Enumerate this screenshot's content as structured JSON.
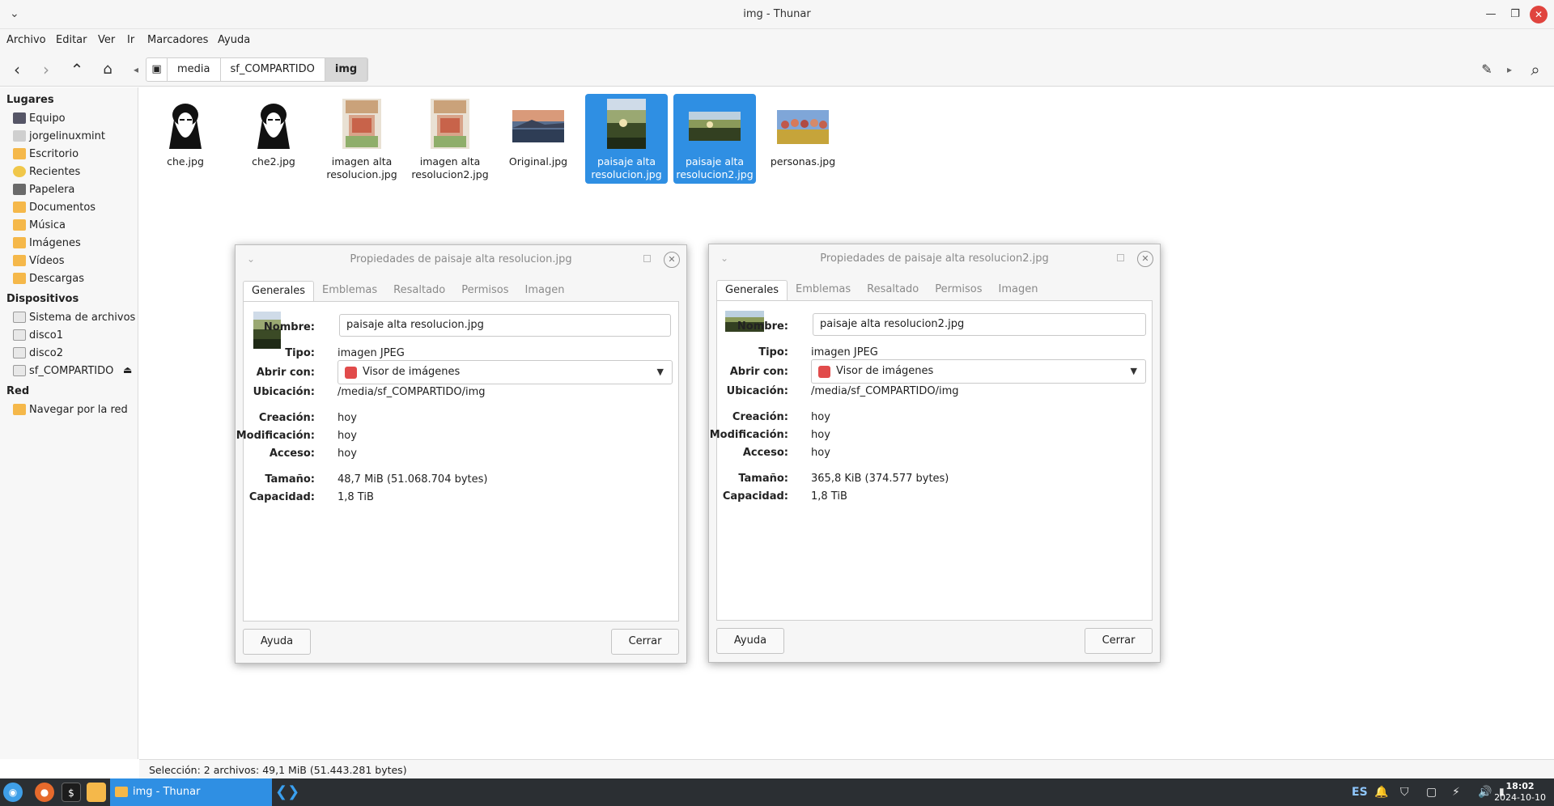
{
  "window": {
    "title": "img - Thunar"
  },
  "menubar": [
    "Archivo",
    "Editar",
    "Ver",
    "Ir",
    "Marcadores",
    "Ayuda"
  ],
  "breadcrumbs": [
    "media",
    "sf_COMPARTIDO",
    "img"
  ],
  "sidebar": {
    "places_header": "Lugares",
    "places": [
      "Equipo",
      "jorgelinuxmint",
      "Escritorio",
      "Recientes",
      "Papelera",
      "Documentos",
      "Música",
      "Imágenes",
      "Vídeos",
      "Descargas"
    ],
    "devices_header": "Dispositivos",
    "devices": [
      "Sistema de archivos",
      "disco1",
      "disco2",
      "sf_COMPARTIDO"
    ],
    "network_header": "Red",
    "network": [
      "Navegar por la red"
    ]
  },
  "files": [
    {
      "line1": "che.jpg",
      "line2": ""
    },
    {
      "line1": "che2.jpg",
      "line2": ""
    },
    {
      "line1": "imagen alta",
      "line2": "resolucion.jpg"
    },
    {
      "line1": "imagen alta",
      "line2": "resolucion2.jpg"
    },
    {
      "line1": "Original.jpg",
      "line2": ""
    },
    {
      "line1": "paisaje alta",
      "line2": "resolucion.jpg"
    },
    {
      "line1": "paisaje alta",
      "line2": "resolucion2.jpg"
    },
    {
      "line1": "personas.jpg",
      "line2": ""
    }
  ],
  "status": "Selección: 2 archivos: 49,1 MiB (51.443.281 bytes)",
  "dialog_tabs": [
    "Generales",
    "Emblemas",
    "Resaltado",
    "Permisos",
    "Imagen"
  ],
  "dialog_labels": {
    "nombre": "Nombre:",
    "tipo": "Tipo:",
    "abrir": "Abrir con:",
    "ubicacion": "Ubicación:",
    "creacion": "Creación:",
    "modificacion": "Modificación:",
    "acceso": "Acceso:",
    "tamano": "Tamaño:",
    "capacidad": "Capacidad:"
  },
  "dialog1": {
    "title": "Propiedades de paisaje alta resolucion.jpg",
    "nombre": "paisaje alta resolucion.jpg",
    "tipo": "imagen JPEG",
    "abrir": "Visor de imágenes",
    "ubicacion": "/media/sf_COMPARTIDO/img",
    "creacion": "hoy",
    "modificacion": "hoy",
    "acceso": "hoy",
    "tamano": "48,7 MiB (51.068.704 bytes)",
    "capacidad": "1,8 TiB",
    "help": "Ayuda",
    "close": "Cerrar"
  },
  "dialog2": {
    "title": "Propiedades de paisaje alta resolucion2.jpg",
    "nombre": "paisaje alta resolucion2.jpg",
    "tipo": "imagen JPEG",
    "abrir": "Visor de imágenes",
    "ubicacion": "/media/sf_COMPARTIDO/img",
    "creacion": "hoy",
    "modificacion": "hoy",
    "acceso": "hoy",
    "tamano": "365,8 KiB (374.577 bytes)",
    "capacidad": "1,8 TiB",
    "help": "Ayuda",
    "close": "Cerrar"
  },
  "taskbar": {
    "task": "img - Thunar",
    "lang": "ES",
    "time": "18:02",
    "date": "2024-10-10"
  }
}
